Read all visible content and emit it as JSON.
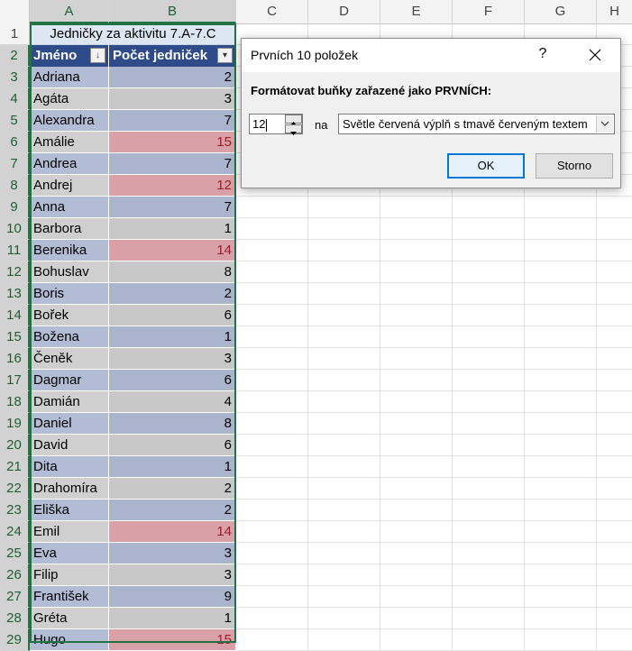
{
  "columns": [
    "A",
    "B",
    "C",
    "D",
    "E",
    "F",
    "G",
    "H"
  ],
  "row_numbers": [
    "1",
    "2",
    "3",
    "4",
    "5",
    "6",
    "7",
    "8",
    "9",
    "10",
    "11",
    "12",
    "13",
    "14",
    "15",
    "16",
    "17",
    "18",
    "19",
    "20",
    "21",
    "22",
    "23",
    "24",
    "25",
    "26",
    "27",
    "28",
    "29"
  ],
  "table": {
    "title": "Jedničky za aktivitu 7.A-7.C",
    "header_name": "Jméno",
    "header_count": "Počet jedniček",
    "rows": [
      {
        "name": "Adriana",
        "count": "2",
        "highlight": false
      },
      {
        "name": "Agáta",
        "count": "3",
        "highlight": false
      },
      {
        "name": "Alexandra",
        "count": "7",
        "highlight": false
      },
      {
        "name": "Amálie",
        "count": "15",
        "highlight": true
      },
      {
        "name": "Andrea",
        "count": "7",
        "highlight": false
      },
      {
        "name": "Andrej",
        "count": "12",
        "highlight": true
      },
      {
        "name": "Anna",
        "count": "7",
        "highlight": false
      },
      {
        "name": "Barbora",
        "count": "1",
        "highlight": false
      },
      {
        "name": "Berenika",
        "count": "14",
        "highlight": true
      },
      {
        "name": "Bohuslav",
        "count": "8",
        "highlight": false
      },
      {
        "name": "Boris",
        "count": "2",
        "highlight": false
      },
      {
        "name": "Bořek",
        "count": "6",
        "highlight": false
      },
      {
        "name": "Božena",
        "count": "1",
        "highlight": false
      },
      {
        "name": "Čeněk",
        "count": "3",
        "highlight": false
      },
      {
        "name": "Dagmar",
        "count": "6",
        "highlight": false
      },
      {
        "name": "Damián",
        "count": "4",
        "highlight": false
      },
      {
        "name": "Daniel",
        "count": "8",
        "highlight": false
      },
      {
        "name": "David",
        "count": "6",
        "highlight": false
      },
      {
        "name": "Dita",
        "count": "1",
        "highlight": false
      },
      {
        "name": "Drahomíra",
        "count": "2",
        "highlight": false
      },
      {
        "name": "Eliška",
        "count": "2",
        "highlight": false
      },
      {
        "name": "Emil",
        "count": "14",
        "highlight": true
      },
      {
        "name": "Eva",
        "count": "3",
        "highlight": false
      },
      {
        "name": "Filip",
        "count": "3",
        "highlight": false
      },
      {
        "name": "František",
        "count": "9",
        "highlight": false
      },
      {
        "name": "Gréta",
        "count": "1",
        "highlight": false
      },
      {
        "name": "Hugo",
        "count": "15",
        "highlight": true
      }
    ]
  },
  "colors": {
    "band_blue_name": "#b2bcd5",
    "band_blue_count": "#aab4cc",
    "band_gray_name": "#cfcfcf",
    "band_gray_count": "#c8c8c8",
    "highlight_fill": "#d9a0a8",
    "highlight_text": "#9c1c2c",
    "header_fill": "#2f4b8a",
    "selection_green": "#217346"
  },
  "dialog": {
    "title": "Prvních 10 položek",
    "help": "?",
    "label": "Formátovat buňky zařazené jako PRVNÍCH:",
    "count_value": "12",
    "na_label": "na",
    "format_selected": "Světle červená výplň s tmavě červeným textem",
    "ok_label": "OK",
    "cancel_label": "Storno"
  }
}
